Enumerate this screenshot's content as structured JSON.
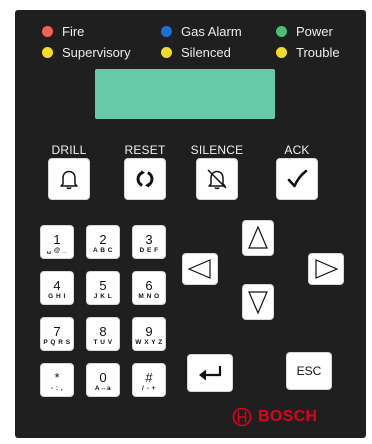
{
  "status_leds": [
    {
      "label": "Fire",
      "color": "#f0674e"
    },
    {
      "label": "Gas Alarm",
      "color": "#1f6fd1"
    },
    {
      "label": "Power",
      "color": "#4bbd7a"
    },
    {
      "label": "Supervisory",
      "color": "#f2dc2a"
    },
    {
      "label": "Silenced",
      "color": "#f2dc2a"
    },
    {
      "label": "Trouble",
      "color": "#f2dc2a"
    }
  ],
  "commands": {
    "drill": {
      "label": "DRILL",
      "icon": "bell-icon"
    },
    "reset": {
      "label": "RESET",
      "icon": "reset-icon"
    },
    "silence": {
      "label": "SILENCE",
      "icon": "bell-muted-icon"
    },
    "ack": {
      "label": "ACK",
      "icon": "checkmark-icon"
    }
  },
  "keypad": [
    {
      "digit": "1",
      "sub": "␣ @ _"
    },
    {
      "digit": "2",
      "sub": "A B C"
    },
    {
      "digit": "3",
      "sub": "D E F"
    },
    {
      "digit": "4",
      "sub": "G H I"
    },
    {
      "digit": "5",
      "sub": "J K L"
    },
    {
      "digit": "6",
      "sub": "M N O"
    },
    {
      "digit": "7",
      "sub": "P Q R S"
    },
    {
      "digit": "8",
      "sub": "T U V"
    },
    {
      "digit": "9",
      "sub": "W X Y Z"
    },
    {
      "digit": "*",
      "sub": "- : ,"
    },
    {
      "digit": "0",
      "sub": "A↔a"
    },
    {
      "digit": "#",
      "sub": "/ - +"
    }
  ],
  "nav": {
    "up_icon": "arrow-up-icon",
    "down_icon": "arrow-down-icon",
    "left_icon": "arrow-left-icon",
    "right_icon": "arrow-right-icon"
  },
  "enter_icon": "enter-icon",
  "esc_label": "ESC",
  "brand": {
    "name": "BOSCH",
    "color": "#e2001a"
  }
}
